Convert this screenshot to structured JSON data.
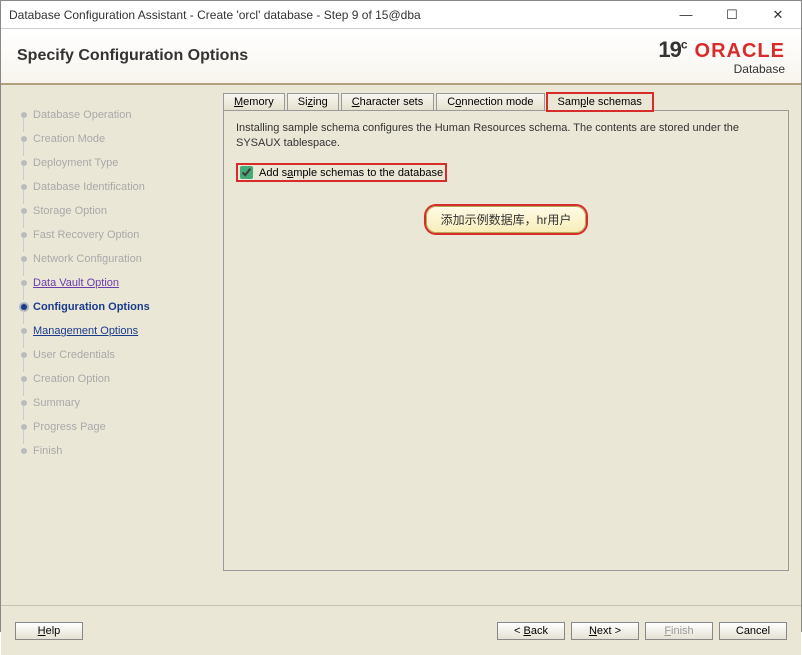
{
  "window": {
    "title": "Database Configuration Assistant - Create 'orcl' database - Step 9 of 15@dba",
    "minimize": "—",
    "maximize": "☐",
    "close": "✕"
  },
  "header": {
    "page_title": "Specify Configuration Options",
    "logo_version": "19",
    "logo_version_sup": "c",
    "logo_brand": "ORACLE",
    "logo_sub": "Database"
  },
  "sidebar": {
    "items": [
      {
        "label": "Database Operation",
        "state": "disabled"
      },
      {
        "label": "Creation Mode",
        "state": "disabled"
      },
      {
        "label": "Deployment Type",
        "state": "disabled"
      },
      {
        "label": "Database Identification",
        "state": "disabled"
      },
      {
        "label": "Storage Option",
        "state": "disabled"
      },
      {
        "label": "Fast Recovery Option",
        "state": "disabled"
      },
      {
        "label": "Network Configuration",
        "state": "disabled"
      },
      {
        "label": "Data Vault Option",
        "state": "link"
      },
      {
        "label": "Configuration Options",
        "state": "current"
      },
      {
        "label": "Management Options",
        "state": "mgmt"
      },
      {
        "label": "User Credentials",
        "state": "disabled"
      },
      {
        "label": "Creation Option",
        "state": "disabled"
      },
      {
        "label": "Summary",
        "state": "disabled"
      },
      {
        "label": "Progress Page",
        "state": "disabled"
      },
      {
        "label": "Finish",
        "state": "disabled"
      }
    ]
  },
  "tabs": {
    "items": [
      {
        "pre": "",
        "u": "M",
        "post": "emory",
        "active": false,
        "highlight": false
      },
      {
        "pre": "Si",
        "u": "z",
        "post": "ing",
        "active": false,
        "highlight": false
      },
      {
        "pre": "",
        "u": "C",
        "post": "haracter sets",
        "active": false,
        "highlight": false
      },
      {
        "pre": "C",
        "u": "o",
        "post": "nnection mode",
        "active": false,
        "highlight": false
      },
      {
        "pre": "Sam",
        "u": "p",
        "post": "le schemas",
        "active": true,
        "highlight": true
      }
    ]
  },
  "panel": {
    "description": "Installing sample schema configures the Human Resources schema. The contents are stored under the SYSAUX tablespace.",
    "checkbox_checked": true,
    "checkbox_pre": "Add s",
    "checkbox_u": "a",
    "checkbox_post": "mple schemas to the database",
    "annotation": "添加示例数据库，hr用户"
  },
  "footer": {
    "help_u": "H",
    "help_post": "elp",
    "back_pre": "< ",
    "back_u": "B",
    "back_post": "ack",
    "next_u": "N",
    "next_post": "ext >",
    "finish_u": "F",
    "finish_post": "inish",
    "cancel": "Cancel"
  }
}
